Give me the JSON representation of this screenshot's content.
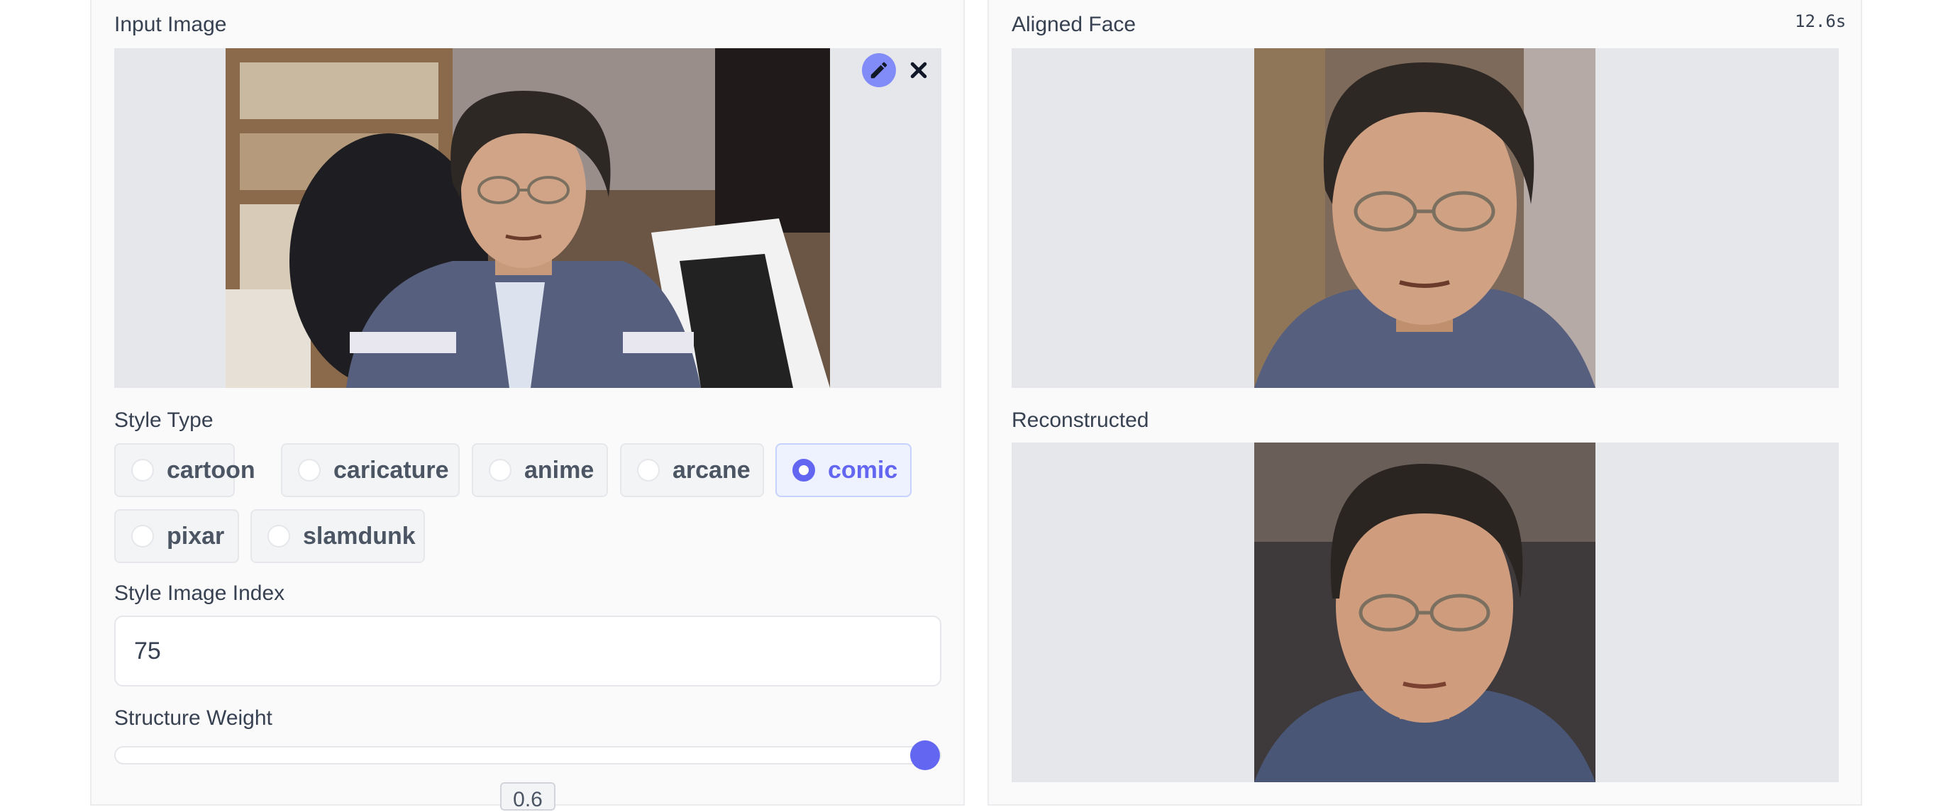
{
  "input_image": {
    "label": "Input Image",
    "edit_icon": "pencil-icon",
    "close_icon": "close-icon"
  },
  "style_type": {
    "label": "Style Type",
    "options": [
      "cartoon",
      "caricature",
      "anime",
      "arcane",
      "comic",
      "pixar",
      "slamdunk"
    ],
    "selected": "comic"
  },
  "style_image_index": {
    "label": "Style Image Index",
    "value": "75"
  },
  "structure_weight": {
    "label": "Structure Weight",
    "value": "0.6",
    "fraction": 1.0
  },
  "aligned_face": {
    "label": "Aligned Face",
    "timer": "12.6s"
  },
  "reconstructed": {
    "label": "Reconstructed"
  },
  "colors": {
    "accent": "#6366f1",
    "accent_light": "#818cf8",
    "panel_bg": "#fafafa",
    "image_bg": "#e5e7eb"
  }
}
